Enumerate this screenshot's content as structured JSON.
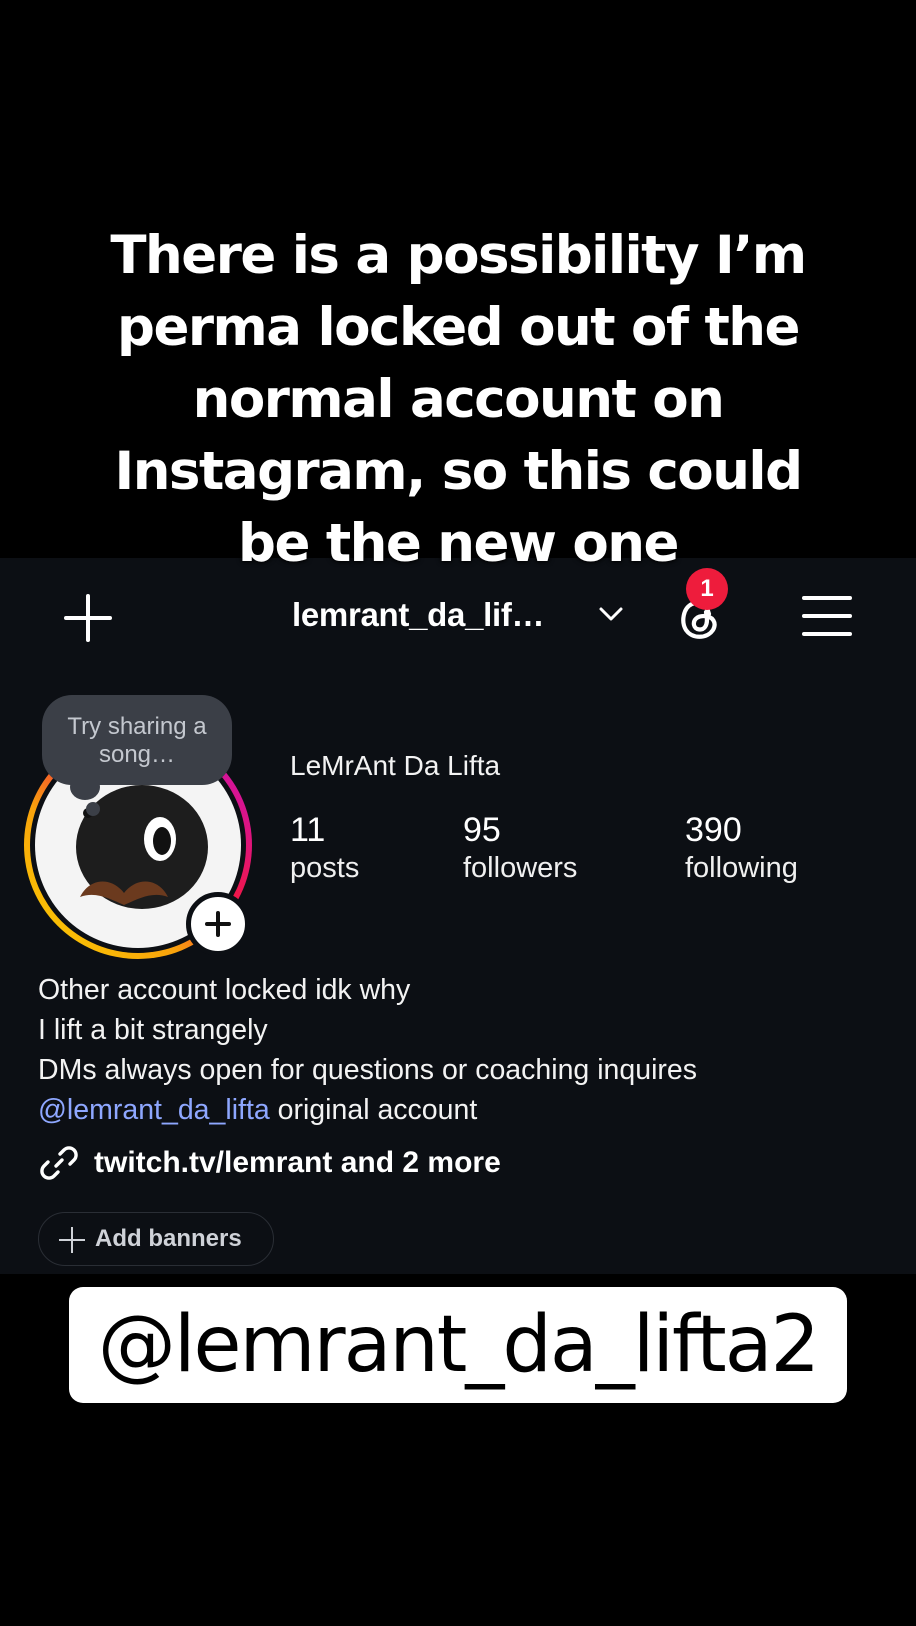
{
  "caption": {
    "lines": [
      "There is a possibility I’m",
      "perma locked out of the",
      "normal account on",
      "Instagram, so this could",
      "be the new one"
    ]
  },
  "header": {
    "username": "lemrant_da_lif…",
    "notification_count": "1",
    "icons": [
      "plus-icon",
      "chevron-down-icon",
      "threads-icon",
      "hamburger-menu-icon"
    ]
  },
  "profile": {
    "note_bubble": "Try sharing a song…",
    "display_name": "LeMrAnt Da Lifta",
    "stats": [
      {
        "value": "11",
        "label": "posts"
      },
      {
        "value": "95",
        "label": "followers"
      },
      {
        "value": "390",
        "label": "following"
      }
    ],
    "bio": [
      "Other account locked idk why",
      "I lift a bit strangely",
      "DMs always open for questions or coaching inquires"
    ],
    "mention": "@lemrant_da_lifta",
    "mention_suffix": " original account",
    "links": "twitch.tv/lemrant and 2 more",
    "add_banners": "Add banners"
  },
  "overlay": {
    "handle": "@lemrant_da_lifta2"
  },
  "colors": {
    "background": "#000000",
    "panel": "#0c0f14",
    "badge": "#ee1c3c",
    "mention": "#8ea7ff"
  }
}
